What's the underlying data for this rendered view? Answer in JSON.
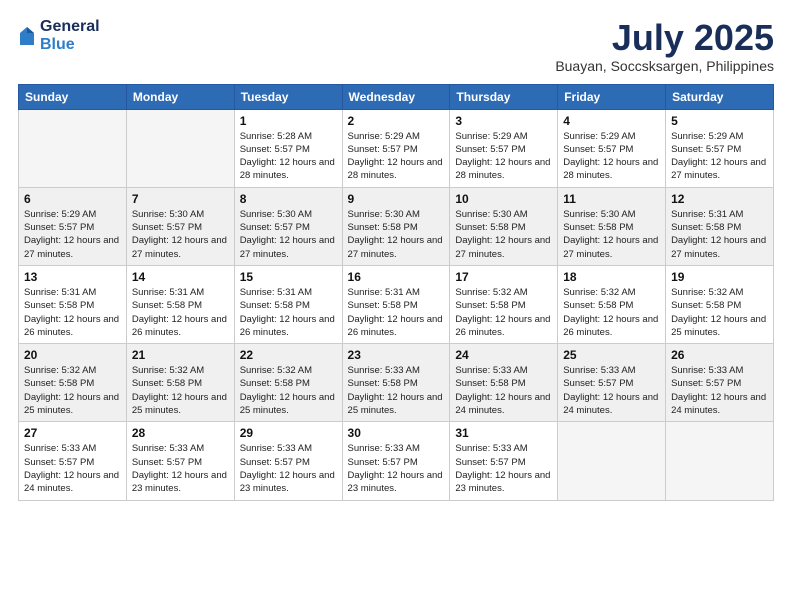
{
  "header": {
    "logo": {
      "general": "General",
      "blue": "Blue"
    },
    "title": "July 2025",
    "location": "Buayan, Soccsksargen, Philippines"
  },
  "weekdays": [
    "Sunday",
    "Monday",
    "Tuesday",
    "Wednesday",
    "Thursday",
    "Friday",
    "Saturday"
  ],
  "weeks": [
    [
      {
        "day": "",
        "sunrise": "",
        "sunset": "",
        "daylight": "",
        "empty": true
      },
      {
        "day": "",
        "sunrise": "",
        "sunset": "",
        "daylight": "",
        "empty": true
      },
      {
        "day": "1",
        "sunrise": "Sunrise: 5:28 AM",
        "sunset": "Sunset: 5:57 PM",
        "daylight": "Daylight: 12 hours and 28 minutes."
      },
      {
        "day": "2",
        "sunrise": "Sunrise: 5:29 AM",
        "sunset": "Sunset: 5:57 PM",
        "daylight": "Daylight: 12 hours and 28 minutes."
      },
      {
        "day": "3",
        "sunrise": "Sunrise: 5:29 AM",
        "sunset": "Sunset: 5:57 PM",
        "daylight": "Daylight: 12 hours and 28 minutes."
      },
      {
        "day": "4",
        "sunrise": "Sunrise: 5:29 AM",
        "sunset": "Sunset: 5:57 PM",
        "daylight": "Daylight: 12 hours and 28 minutes."
      },
      {
        "day": "5",
        "sunrise": "Sunrise: 5:29 AM",
        "sunset": "Sunset: 5:57 PM",
        "daylight": "Daylight: 12 hours and 27 minutes."
      }
    ],
    [
      {
        "day": "6",
        "sunrise": "Sunrise: 5:29 AM",
        "sunset": "Sunset: 5:57 PM",
        "daylight": "Daylight: 12 hours and 27 minutes."
      },
      {
        "day": "7",
        "sunrise": "Sunrise: 5:30 AM",
        "sunset": "Sunset: 5:57 PM",
        "daylight": "Daylight: 12 hours and 27 minutes."
      },
      {
        "day": "8",
        "sunrise": "Sunrise: 5:30 AM",
        "sunset": "Sunset: 5:57 PM",
        "daylight": "Daylight: 12 hours and 27 minutes."
      },
      {
        "day": "9",
        "sunrise": "Sunrise: 5:30 AM",
        "sunset": "Sunset: 5:58 PM",
        "daylight": "Daylight: 12 hours and 27 minutes."
      },
      {
        "day": "10",
        "sunrise": "Sunrise: 5:30 AM",
        "sunset": "Sunset: 5:58 PM",
        "daylight": "Daylight: 12 hours and 27 minutes."
      },
      {
        "day": "11",
        "sunrise": "Sunrise: 5:30 AM",
        "sunset": "Sunset: 5:58 PM",
        "daylight": "Daylight: 12 hours and 27 minutes."
      },
      {
        "day": "12",
        "sunrise": "Sunrise: 5:31 AM",
        "sunset": "Sunset: 5:58 PM",
        "daylight": "Daylight: 12 hours and 27 minutes."
      }
    ],
    [
      {
        "day": "13",
        "sunrise": "Sunrise: 5:31 AM",
        "sunset": "Sunset: 5:58 PM",
        "daylight": "Daylight: 12 hours and 26 minutes."
      },
      {
        "day": "14",
        "sunrise": "Sunrise: 5:31 AM",
        "sunset": "Sunset: 5:58 PM",
        "daylight": "Daylight: 12 hours and 26 minutes."
      },
      {
        "day": "15",
        "sunrise": "Sunrise: 5:31 AM",
        "sunset": "Sunset: 5:58 PM",
        "daylight": "Daylight: 12 hours and 26 minutes."
      },
      {
        "day": "16",
        "sunrise": "Sunrise: 5:31 AM",
        "sunset": "Sunset: 5:58 PM",
        "daylight": "Daylight: 12 hours and 26 minutes."
      },
      {
        "day": "17",
        "sunrise": "Sunrise: 5:32 AM",
        "sunset": "Sunset: 5:58 PM",
        "daylight": "Daylight: 12 hours and 26 minutes."
      },
      {
        "day": "18",
        "sunrise": "Sunrise: 5:32 AM",
        "sunset": "Sunset: 5:58 PM",
        "daylight": "Daylight: 12 hours and 26 minutes."
      },
      {
        "day": "19",
        "sunrise": "Sunrise: 5:32 AM",
        "sunset": "Sunset: 5:58 PM",
        "daylight": "Daylight: 12 hours and 25 minutes."
      }
    ],
    [
      {
        "day": "20",
        "sunrise": "Sunrise: 5:32 AM",
        "sunset": "Sunset: 5:58 PM",
        "daylight": "Daylight: 12 hours and 25 minutes."
      },
      {
        "day": "21",
        "sunrise": "Sunrise: 5:32 AM",
        "sunset": "Sunset: 5:58 PM",
        "daylight": "Daylight: 12 hours and 25 minutes."
      },
      {
        "day": "22",
        "sunrise": "Sunrise: 5:32 AM",
        "sunset": "Sunset: 5:58 PM",
        "daylight": "Daylight: 12 hours and 25 minutes."
      },
      {
        "day": "23",
        "sunrise": "Sunrise: 5:33 AM",
        "sunset": "Sunset: 5:58 PM",
        "daylight": "Daylight: 12 hours and 25 minutes."
      },
      {
        "day": "24",
        "sunrise": "Sunrise: 5:33 AM",
        "sunset": "Sunset: 5:58 PM",
        "daylight": "Daylight: 12 hours and 24 minutes."
      },
      {
        "day": "25",
        "sunrise": "Sunrise: 5:33 AM",
        "sunset": "Sunset: 5:57 PM",
        "daylight": "Daylight: 12 hours and 24 minutes."
      },
      {
        "day": "26",
        "sunrise": "Sunrise: 5:33 AM",
        "sunset": "Sunset: 5:57 PM",
        "daylight": "Daylight: 12 hours and 24 minutes."
      }
    ],
    [
      {
        "day": "27",
        "sunrise": "Sunrise: 5:33 AM",
        "sunset": "Sunset: 5:57 PM",
        "daylight": "Daylight: 12 hours and 24 minutes."
      },
      {
        "day": "28",
        "sunrise": "Sunrise: 5:33 AM",
        "sunset": "Sunset: 5:57 PM",
        "daylight": "Daylight: 12 hours and 23 minutes."
      },
      {
        "day": "29",
        "sunrise": "Sunrise: 5:33 AM",
        "sunset": "Sunset: 5:57 PM",
        "daylight": "Daylight: 12 hours and 23 minutes."
      },
      {
        "day": "30",
        "sunrise": "Sunrise: 5:33 AM",
        "sunset": "Sunset: 5:57 PM",
        "daylight": "Daylight: 12 hours and 23 minutes."
      },
      {
        "day": "31",
        "sunrise": "Sunrise: 5:33 AM",
        "sunset": "Sunset: 5:57 PM",
        "daylight": "Daylight: 12 hours and 23 minutes."
      },
      {
        "day": "",
        "sunrise": "",
        "sunset": "",
        "daylight": "",
        "empty": true
      },
      {
        "day": "",
        "sunrise": "",
        "sunset": "",
        "daylight": "",
        "empty": true
      }
    ]
  ]
}
